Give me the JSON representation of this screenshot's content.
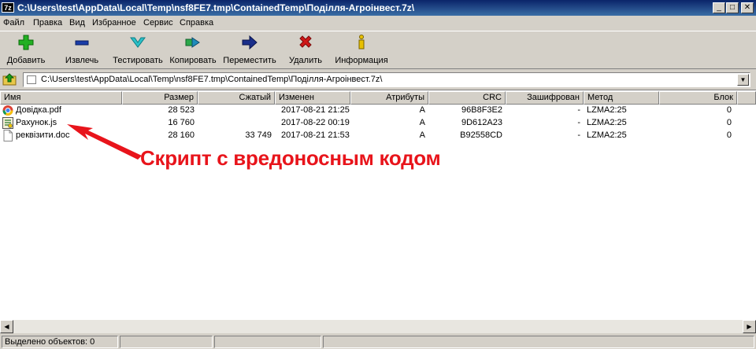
{
  "window": {
    "app_icon": "7z",
    "title": "C:\\Users\\test\\AppData\\Local\\Temp\\nsf8FE7.tmp\\ContainedTemp\\Поділля-Агроінвест.7z\\",
    "controls": {
      "minimize": "_",
      "maximize": "□",
      "close": "✕"
    }
  },
  "menu": [
    "Файл",
    "Правка",
    "Вид",
    "Избранное",
    "Сервис",
    "Справка"
  ],
  "toolbar": [
    {
      "label": "Добавить",
      "icon": "add-icon"
    },
    {
      "label": "Извлечь",
      "icon": "extract-icon"
    },
    {
      "label": "Тестировать",
      "icon": "test-icon"
    },
    {
      "label": "Копировать",
      "icon": "copy-icon"
    },
    {
      "label": "Переместить",
      "icon": "move-icon"
    },
    {
      "label": "Удалить",
      "icon": "delete-icon"
    },
    {
      "label": "Информация",
      "icon": "info-icon"
    }
  ],
  "address": {
    "path": "C:\\Users\\test\\AppData\\Local\\Temp\\nsf8FE7.tmp\\ContainedTemp\\Поділля-Агроінвест.7z\\"
  },
  "columns": [
    "Имя",
    "Размер",
    "Сжатый",
    "Изменен",
    "Атрибуты",
    "CRC",
    "Зашифрован",
    "Метод",
    "Блок"
  ],
  "files": [
    {
      "name": "Довідка.pdf",
      "size": "28 523",
      "packed": "",
      "modified": "2017-08-21 21:25",
      "attributes": "A",
      "crc": "96B8F3E2",
      "encrypted": "-",
      "method": "LZMA2:25",
      "block": "0",
      "icon": "pdf-chrome-icon"
    },
    {
      "name": "Рахунок.js",
      "size": "16 760",
      "packed": "",
      "modified": "2017-08-22 00:19",
      "attributes": "A",
      "crc": "9D612A23",
      "encrypted": "-",
      "method": "LZMA2:25",
      "block": "0",
      "icon": "script-icon"
    },
    {
      "name": "реквізити.doc",
      "size": "28 160",
      "packed": "33 749",
      "modified": "2017-08-21 21:53",
      "attributes": "A",
      "crc": "B92558CD",
      "encrypted": "-",
      "method": "LZMA2:25",
      "block": "0",
      "icon": "document-icon"
    }
  ],
  "status": {
    "selected": "Выделено объектов: 0"
  },
  "annotation": {
    "text": "Скрипт с вредоносным кодом",
    "color": "#e8141b"
  }
}
